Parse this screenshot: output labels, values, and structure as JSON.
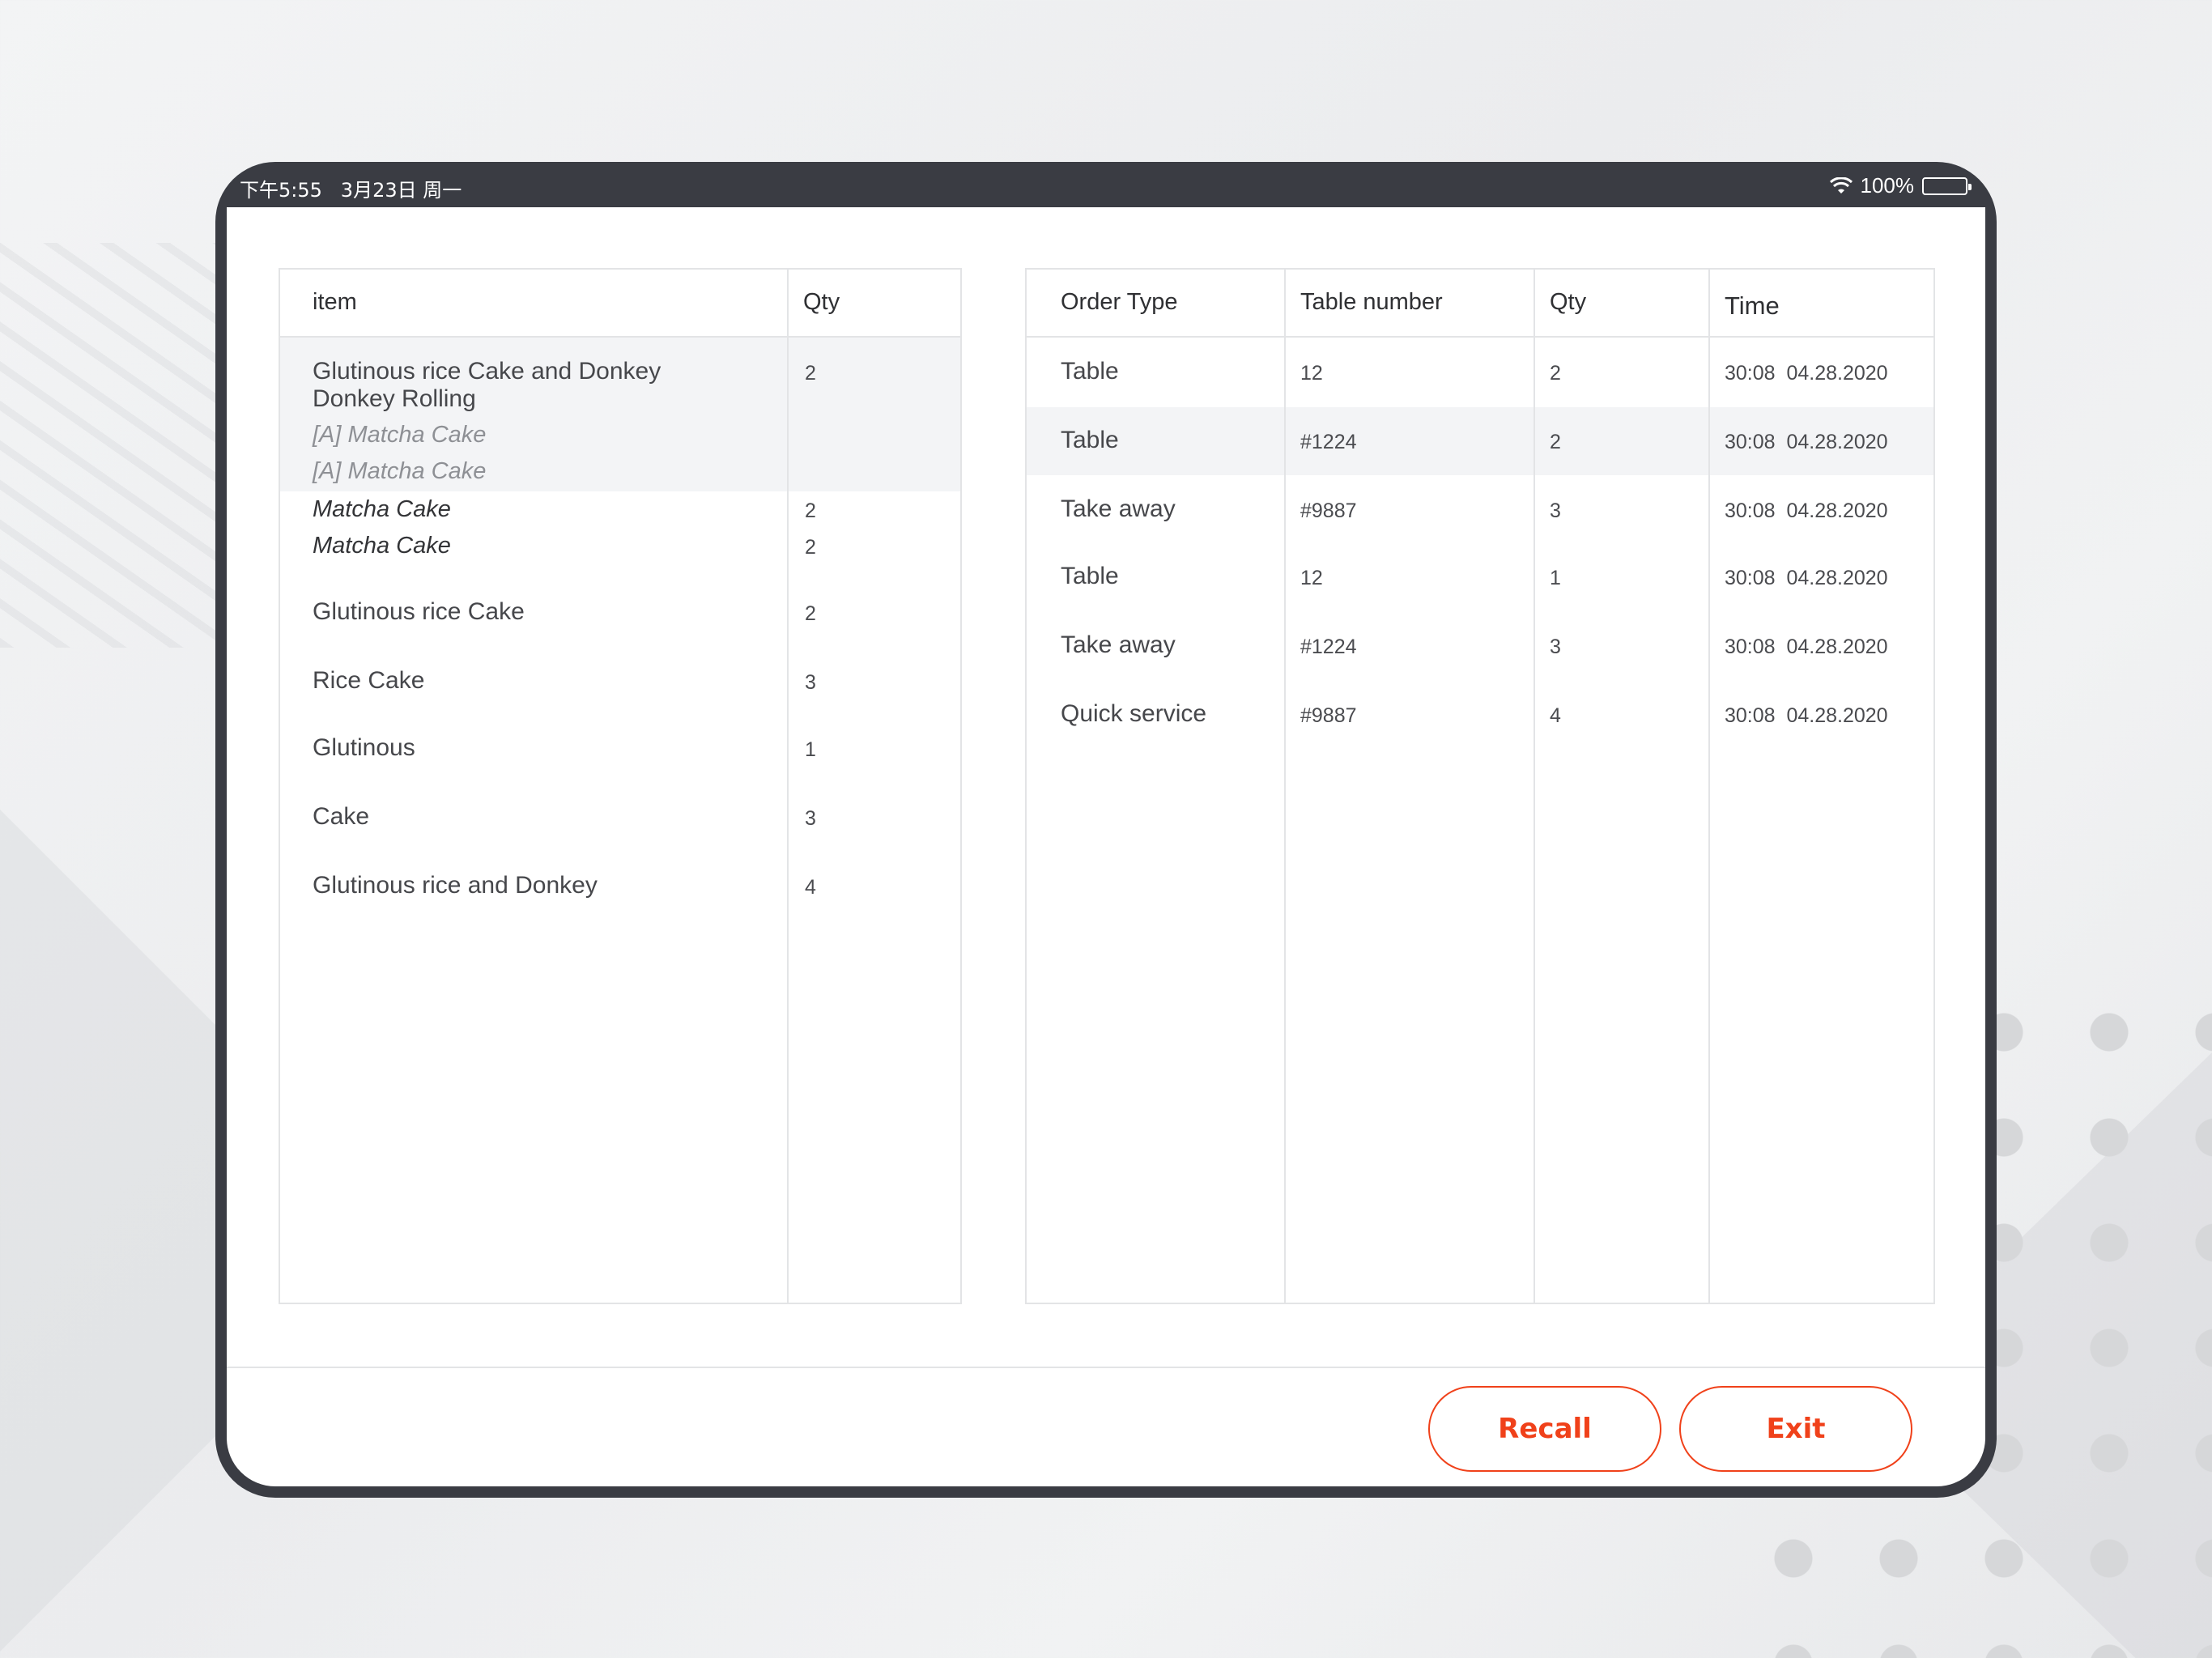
{
  "status_bar": {
    "time": "下午5:55",
    "date": "3月23日 周一",
    "battery": "100%"
  },
  "items_table": {
    "headers": {
      "item": "item",
      "qty": "Qty"
    },
    "rows": [
      {
        "item": "Glutinous rice Cake and Donkey",
        "item_line2": "Donkey Rolling",
        "qty": "2",
        "modifiers": [
          "[A] Matcha Cake",
          "[A] Matcha Cake"
        ]
      },
      {
        "item": "Matcha Cake",
        "qty": "2"
      },
      {
        "item": "Matcha Cake",
        "qty": "2"
      },
      {
        "item": "Glutinous rice Cake",
        "qty": "2"
      },
      {
        "item": "Rice Cake",
        "qty": "3"
      },
      {
        "item": "Glutinous",
        "qty": "1"
      },
      {
        "item": "Cake",
        "qty": "3"
      },
      {
        "item": "Glutinous rice and Donkey",
        "qty": "4"
      }
    ]
  },
  "orders_table": {
    "headers": {
      "order_type": "Order Type",
      "table_number": "Table number",
      "qty": "Qty",
      "time": "Time"
    },
    "rows": [
      {
        "order_type": "Table",
        "table_number": "12",
        "qty": "2",
        "time": "30:08  04.28.2020"
      },
      {
        "order_type": "Table",
        "table_number": "#1224",
        "qty": "2",
        "time": "30:08  04.28.2020"
      },
      {
        "order_type": "Take away",
        "table_number": "#9887",
        "qty": "3",
        "time": "30:08  04.28.2020"
      },
      {
        "order_type": "Table",
        "table_number": "12",
        "qty": "1",
        "time": "30:08  04.28.2020"
      },
      {
        "order_type": "Take away",
        "table_number": "#1224",
        "qty": "3",
        "time": "30:08  04.28.2020"
      },
      {
        "order_type": "Quick service",
        "table_number": "#9887",
        "qty": "4",
        "time": "30:08  04.28.2020"
      }
    ]
  },
  "footer": {
    "recall_label": "Recall",
    "exit_label": "Exit"
  },
  "colors": {
    "accent": "#f0411a",
    "bezel": "#3a3c43",
    "row_highlight": "#f3f4f6"
  }
}
